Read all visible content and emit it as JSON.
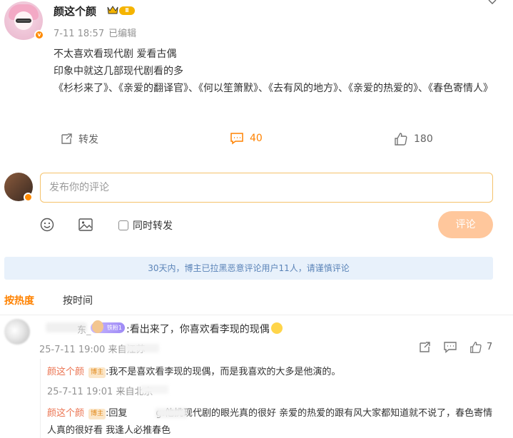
{
  "post": {
    "author": "颜这个颜",
    "time": "7-11 18:57",
    "edited": "已编辑",
    "body_lines": [
      "不太喜欢看现代剧 爱看古偶",
      "印象中就这几部现代剧看的多",
      "《杉杉来了》、《亲爱的翻译官》、《何以笙箫默》、《去有风的地方》、《亲爱的热爱的》、《春色寄情人》"
    ],
    "actions": {
      "repost_label": "转发",
      "comment_count": "40",
      "like_count": "180"
    }
  },
  "composer": {
    "placeholder": "发布你的评论",
    "repost_option": "同时转发",
    "submit_label": "评论"
  },
  "notice": "30天内，博主已拉黑恶意评论用户11人，请谨慎评论",
  "sort": {
    "hot": "按热度",
    "time": "按时间"
  },
  "comment": {
    "name_suffix": "东_",
    "text": ":看出来了，你喜欢看李现的现偶",
    "meta": "25-7-11 19:00 来自江苏",
    "like_count": "7"
  },
  "replies": [
    {
      "name": "颜这个颜",
      "tag": "博主",
      "text": ":我不是喜欢看李现的现偶，而是我喜欢的大多是他演的。",
      "meta": "25-7-11 19:01 来自北京"
    },
    {
      "name": "颜这个颜",
      "tag": "博主",
      "prefix": ":回复",
      "text": "g:他挑现代剧的眼光真的很好 亲爱的热爱的跟有风大家都知道就不说了，春色寄情人真的很好看 我逢人必推春色"
    }
  ],
  "colors": {
    "accent": "#ff8200",
    "link_name": "#eb7350",
    "notice_bg": "#e8f1fb",
    "submit_bg": "#ffc79c"
  }
}
